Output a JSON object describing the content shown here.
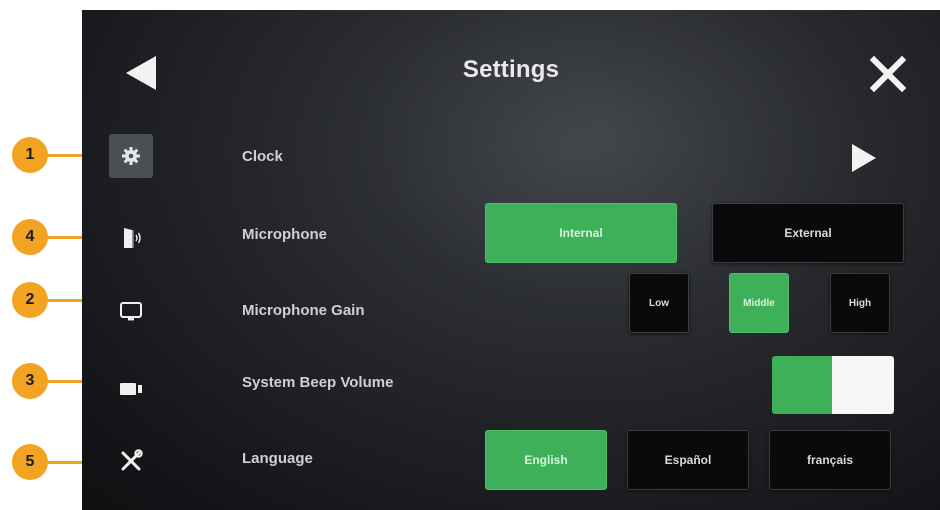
{
  "title": "Settings",
  "rows": {
    "clock": {
      "label": "Clock"
    },
    "microphone": {
      "label": "Microphone",
      "options": [
        "Internal",
        "External"
      ],
      "selected": "Internal"
    },
    "microphone_gain": {
      "label": "Microphone Gain",
      "options": [
        "Low",
        "Middle",
        "High"
      ],
      "selected": "Middle"
    },
    "system_beep_volume": {
      "label": "System Beep Volume",
      "toggle_on": true
    },
    "language": {
      "label": "Language",
      "options": [
        "English",
        "Español",
        "français"
      ],
      "selected": "English"
    }
  },
  "sidebar_icons": [
    "gear-icon",
    "speaker-door-icon",
    "monitor-icon",
    "camera-icon",
    "tools-icon"
  ],
  "callouts": [
    "1",
    "4",
    "2",
    "3",
    "5"
  ],
  "colors": {
    "accent_green": "#3fb05a",
    "callout_orange": "#f2a322",
    "background": "#1c1e21"
  }
}
